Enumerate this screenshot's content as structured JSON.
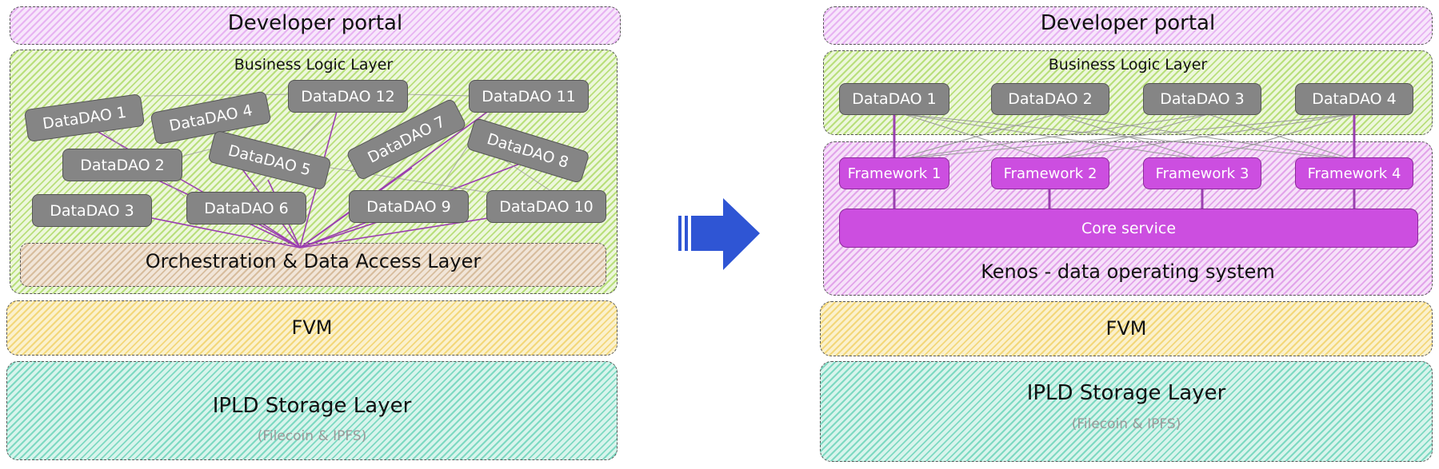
{
  "left": {
    "developer_portal": "Developer portal",
    "business_logic_layer": "Business Logic Layer",
    "orchestration_layer": "Orchestration & Data Access Layer",
    "fvm": "FVM",
    "ipld_title": "IPLD Storage Layer",
    "ipld_subtitle": "(Filecoin & IPFS)",
    "daos": [
      "DataDAO 1",
      "DataDAO 4",
      "DataDAO 12",
      "DataDAO 11",
      "DataDAO 7",
      "DataDAO 8",
      "DataDAO 2",
      "DataDAO 5",
      "DataDAO 3",
      "DataDAO 6",
      "DataDAO 9",
      "DataDAO 10"
    ]
  },
  "right": {
    "developer_portal": "Developer portal",
    "business_logic_layer": "Business Logic Layer",
    "daos": [
      "DataDAO 1",
      "DataDAO 2",
      "DataDAO 3",
      "DataDAO 4"
    ],
    "frameworks": [
      "Framework 1",
      "Framework 2",
      "Framework 3",
      "Framework 4"
    ],
    "core_service": "Core service",
    "kenos": "Kenos - data operating system",
    "fvm": "FVM",
    "ipld_title": "IPLD Storage Layer",
    "ipld_subtitle": "(Filecoin & IPFS)"
  },
  "colors": {
    "arrow": "#2f55d4",
    "dao_fill": "#858585",
    "framework_fill": "#cc4ee0",
    "connector_purple": "#9b3fb0"
  },
  "icons": [
    "right-arrow-icon"
  ]
}
